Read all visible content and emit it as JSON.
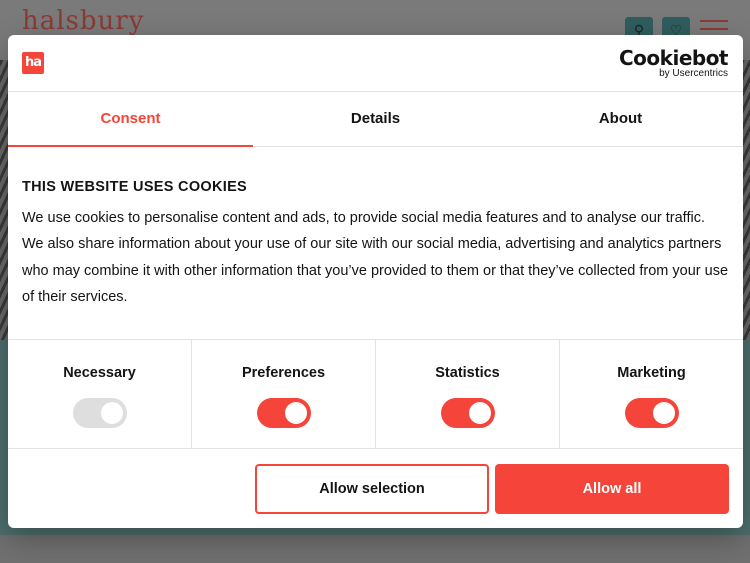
{
  "site": {
    "logo_text": "halsbury",
    "search_icon": "search-icon",
    "heart_icon": "heart-icon",
    "menu_icon": "hamburger-menu-icon"
  },
  "dialog": {
    "brand_logo": "ha",
    "cookiebot": {
      "name": "Cookiebot",
      "by": "by Usercentrics"
    },
    "tabs": [
      {
        "label": "Consent",
        "active": true
      },
      {
        "label": "Details",
        "active": false
      },
      {
        "label": "About",
        "active": false
      }
    ],
    "heading": "THIS WEBSITE USES COOKIES",
    "body": "We use cookies to personalise content and ads, to provide social media features and to analyse our traffic. We also share information about your use of our site with our social media, advertising and analytics partners who may combine it with other information that you’ve provided to them or that they’ve collected from your use of their services.",
    "toggles": [
      {
        "label": "Necessary",
        "on": true,
        "disabled": true
      },
      {
        "label": "Preferences",
        "on": true,
        "disabled": false
      },
      {
        "label": "Statistics",
        "on": true,
        "disabled": false
      },
      {
        "label": "Marketing",
        "on": true,
        "disabled": false
      }
    ],
    "buttons": {
      "allow_selection": "Allow selection",
      "allow_all": "Allow all"
    }
  },
  "colors": {
    "accent": "#f5453b",
    "text": "#141414",
    "border": "#e3e3e3",
    "toggle_disabled": "#dedede"
  }
}
